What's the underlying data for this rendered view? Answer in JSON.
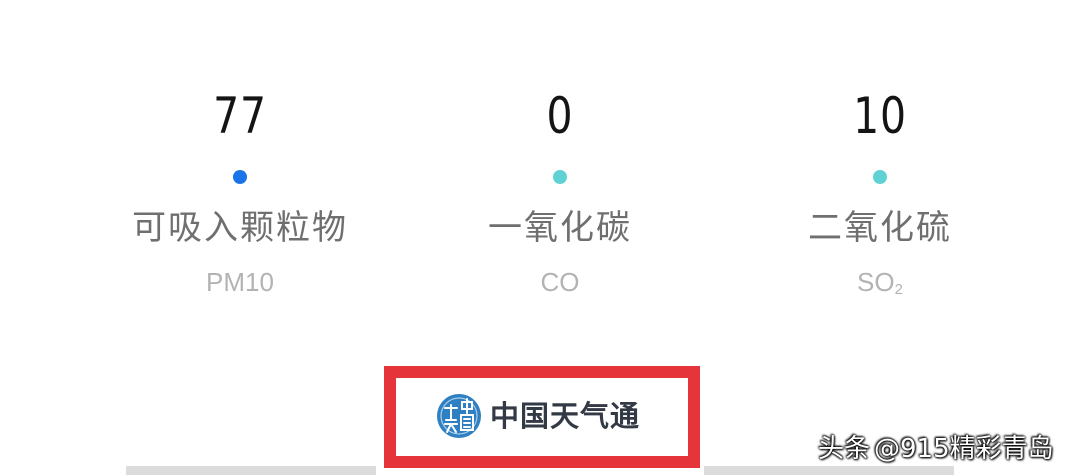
{
  "metrics": [
    {
      "value": "77",
      "name": "可吸入颗粒物",
      "code": "PM10",
      "code_sub": "",
      "dot_color": "#1a73e8"
    },
    {
      "value": "0",
      "name": "一氧化碳",
      "code": "CO",
      "code_sub": "",
      "dot_color": "#5fd3d3"
    },
    {
      "value": "10",
      "name": "二氧化硫",
      "code": "SO",
      "code_sub": "2",
      "dot_color": "#5fd3d3"
    }
  ],
  "brand": {
    "name": "中国天气通",
    "logo_icon": "china-weather-seal-logo",
    "highlight_color": "#e6353a"
  },
  "watermark": {
    "platform": "头条",
    "handle": "@915精彩青岛"
  }
}
